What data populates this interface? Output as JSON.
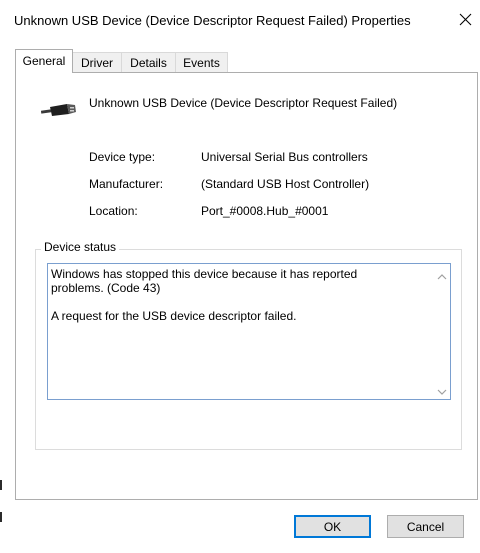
{
  "window": {
    "title": "Unknown USB Device (Device Descriptor Request Failed) Properties"
  },
  "tabs": [
    {
      "label": "General",
      "active": true
    },
    {
      "label": "Driver",
      "active": false
    },
    {
      "label": "Details",
      "active": false
    },
    {
      "label": "Events",
      "active": false
    }
  ],
  "device": {
    "name": "Unknown USB Device (Device Descriptor Request Failed)",
    "icon": "usb-icon",
    "properties": [
      {
        "label": "Device type:",
        "value": "Universal Serial Bus controllers"
      },
      {
        "label": "Manufacturer:",
        "value": "(Standard USB Host Controller)"
      },
      {
        "label": "Location:",
        "value": "Port_#0008.Hub_#0001"
      }
    ]
  },
  "status": {
    "group_label": "Device status",
    "text": "Windows has stopped this device because it has reported\nproblems. (Code 43)\n\nA request for the USB device descriptor failed."
  },
  "buttons": {
    "ok": "OK",
    "cancel": "Cancel"
  },
  "colors": {
    "accent": "#0078d7",
    "border": "#adadad",
    "button_face": "#e1e1e1"
  }
}
